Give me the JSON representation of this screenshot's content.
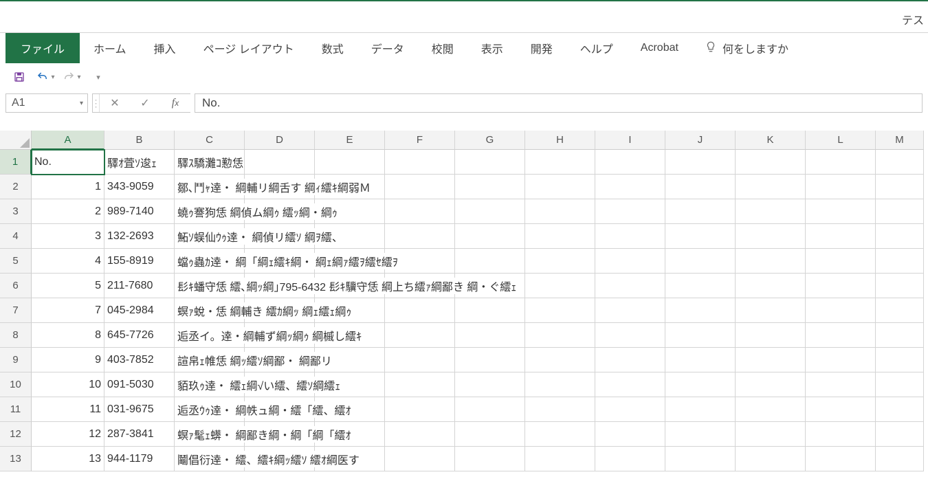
{
  "app_title": "テス",
  "ribbon": {
    "file": "ファイル",
    "tabs": [
      "ホーム",
      "挿入",
      "ページ レイアウト",
      "数式",
      "データ",
      "校閲",
      "表示",
      "開発",
      "ヘルプ",
      "Acrobat"
    ],
    "tellme_label": "何をしますか"
  },
  "namebox_value": "A1",
  "formula_bar_value": "No.",
  "columns": [
    "A",
    "B",
    "C",
    "D",
    "E",
    "F",
    "G",
    "H",
    "I",
    "J",
    "K",
    "L",
    "M"
  ],
  "active_col": "A",
  "active_row": 1,
  "row_count": 13,
  "rows": [
    {
      "a": "No.",
      "b": "驛ｵ萓ｿ逡ｪ",
      "c": "驛ｽ驕灘ｺ懃恁"
    },
    {
      "a": "1",
      "b": "343-9059",
      "c": "鄒､鬥ｬ逹・  綱輔リ綱舌す  綱ｨ繧ｷ綱弱Ｍ"
    },
    {
      "a": "2",
      "b": "989-7140",
      "c": "蟯ｩ謇狗恁  綱偵ム綱ｩ  繧ｯ綱・綱ｩ"
    },
    {
      "a": "3",
      "b": "132-2693",
      "c": "鮖ｿ蜈仙ｳｩ逹・  綱偵リ繧ｿ  綱ｦ繧、"
    },
    {
      "a": "4",
      "b": "155-8919",
      "c": "蟷ｩ蟲ｶ逹・  綱「綱ｪ繧ｷ綱・  綱ｪ綱ｧ繧ｦ繧ｾ繧ｦ"
    },
    {
      "a": "5",
      "b": "211-7680",
      "c": "髟ｷ蟠守恁  繧､綱ｯ綱｣795-6432  髟ｷ驥守恁  綱上ち繧ｧ綱鄙き  綱・ぐ繧ｪ"
    },
    {
      "a": "7",
      "b": "045-2984",
      "c": "螟ｧ蛻・恁  綱輔き  繧ｶ綱ｯ  綱ｪ繧ｪ綱ｩ"
    },
    {
      "a": "8",
      "b": "645-7726",
      "c": "逅丞イ。逹・綱輔ず綱ｯ綱ｩ  綱槭し繧ｷ"
    },
    {
      "a": "9",
      "b": "403-7852",
      "c": "諠帛ｪ帷恁  綱ｯ繧ｿ綱鄙・  綱鄙リ"
    },
    {
      "a": "10",
      "b": "091-5030",
      "c": "貊玖ｩ逹・  繧ｪ綱√い繧、繧ｿ綱繧ｪ"
    },
    {
      "a": "11",
      "b": "031-9675",
      "c": "逅丞ｳｩ逹・  綱帙ュ綱・繧「繧、繧ｵ"
    },
    {
      "a": "12",
      "b": "287-3841",
      "c": "螟ｧ髦ｪ蠎・  綱鄙き綱・綱「綱「繧ｵ"
    },
    {
      "a": "13",
      "b": "944-1179",
      "c": "鬮倡衍逹・  繧、繧ｷ綱ｯ繧ｿ  繧ｵ綱医す"
    }
  ]
}
